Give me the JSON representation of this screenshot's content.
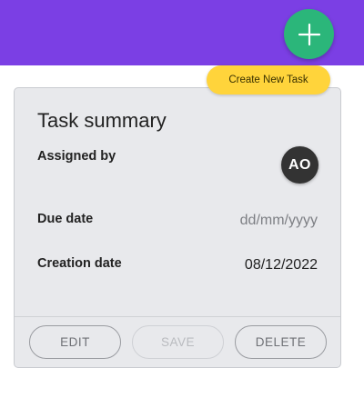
{
  "colors": {
    "topbar": "#7b3fe4",
    "fab": "#2bb67a",
    "tooltip": "#ffd43b",
    "card_bg": "#e8e9ec",
    "avatar_bg": "#333333"
  },
  "fab": {
    "icon": "plus-icon"
  },
  "tooltip": {
    "text": "Create New Task"
  },
  "card": {
    "title": "Task summary",
    "assigned_by": {
      "label": "Assigned by",
      "avatar_initials": "AO"
    },
    "due_date": {
      "label": "Due date",
      "placeholder": "dd/mm/yyyy"
    },
    "creation_date": {
      "label": "Creation date",
      "value": "08/12/2022"
    }
  },
  "actions": {
    "edit_label": "EDIT",
    "save_label": "SAVE",
    "delete_label": "DELETE"
  }
}
